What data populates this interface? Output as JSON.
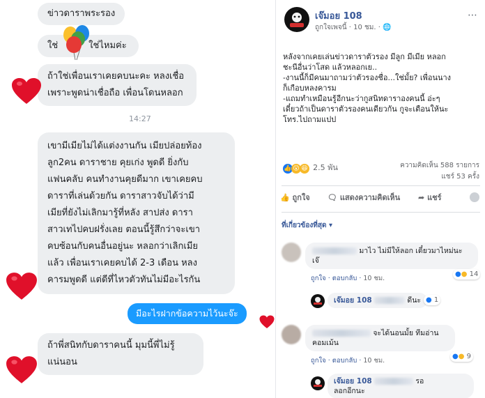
{
  "chat": {
    "messages": [
      {
        "text": "ข่าวดาราพระรอง"
      },
      {
        "text": "ใช่ไหมค่ะ",
        "prefix": "ใช่"
      },
      {
        "lines": [
          "ถ้าใช่เพื่อนเราเคยคบนะคะ หลงเชื่อ",
          "เพราะพูดน่าเชื่อถือ เพื่อนโดนหลอก"
        ]
      },
      {
        "lines": [
          "เขามีเมียไม่ได้แต่งงานกัน เมียปล่อยท้อง",
          "ลูก2คน  ดาราชาย คุยเก่ง พูดดี ยิ่งกับ",
          "แฟนคลับ คนทำงานคุยดีมาก เขาเคยคบ",
          "ดาราที่เล่นด้วยกัน  ดาราสาวจับได้ว่ามี",
          "เมียที่ยังไม่เลิกมารู้ที่หลัง สาปส่ง ดารา",
          "สาวเทไปคบฝรั่งเลย ตอนนี้รู้สึกว่าจะเขา",
          "คบซ้อนกับคนอื่นอยู่นะ หลอกว่าเลิกเมีย",
          "แล้ว เพื่อนเราเคยคบได้ 2-3 เดือน หลง",
          "คารมพูดดี แต่ดีที่ไหวตัวทันไม่มีอะไรกัน"
        ]
      },
      {
        "text": "มีอะไรฝากข้อความไว้นะจ๊ะ"
      },
      {
        "lines": [
          "ถ้าพี่สนิทกับดาราคนนี้ มุมนี้พี่ไม่รู้",
          "แน่นอน"
        ]
      }
    ],
    "time": "14:27"
  },
  "post": {
    "page_name": "เจ๊มอย 108",
    "shared_by": "ถูกใจเพจนี้",
    "time_ago": "10 ชม.",
    "body_lines": [
      "หลังจากเคยเล่นข่าวดาราตัวรอง มีลูก มีเมีย หลอก",
      "ชะนีอื่นว่าโสด แล้วหลอกเย..",
      "-งานนี้ก็มีคนมาถามว่าตัวรองชื่อ...ใช่มั้ย? เพื่อนนาง",
      "ก็เกือบหลงคารม",
      "-แถมทำเหมือนรู้อีกนะว่ากูสนิทดาราองคนนี้ อ่ะๆ",
      "เดี๋ยวถ้าเป็นดาราตัวรองคนเดียวกัน กูจะเตือนให้นะ",
      "โทร.ไปถามแปป"
    ],
    "reactions_count": "2.5 พัน",
    "comments_count": "ความคิดเห็น 588 รายการ",
    "shares_count": "แชร์ 53 ครั้ง",
    "actions": {
      "like": "ถูกใจ",
      "comment": "แสดงความคิดเห็น",
      "share": "แชร์"
    },
    "sort_label": "ที่เกี่ยวข้องที่สุด",
    "comments": [
      {
        "text": "มาไว ไม่มีให้ลอก เดี๋ยวมาไหม่นะ",
        "text2": "เจ๊",
        "like": "ถูกใจ",
        "reply": "ตอบกลับ",
        "time": "10 ชม.",
        "count": "14"
      },
      {
        "name": "เจ๊มอย 108",
        "text": "ดีนะ",
        "count": "1"
      },
      {
        "text": "จะได้นอนมั้ย ทีมอ่าน",
        "text2": "คอมเม้น",
        "like": "ถูกใจ",
        "reply": "ตอบกลับ",
        "time": "10 ชม.",
        "count": "9"
      },
      {
        "name": "เจ๊มอย 108",
        "text": "รอ",
        "text2": "ลอกอีกนะ"
      }
    ]
  }
}
